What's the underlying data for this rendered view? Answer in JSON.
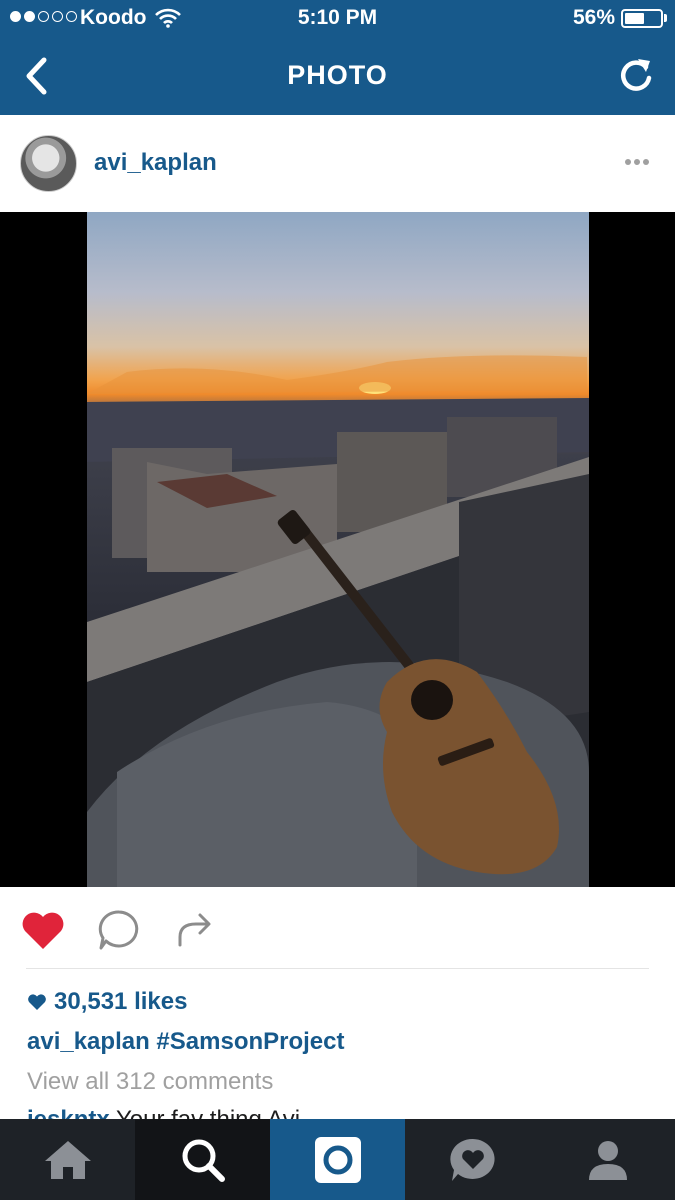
{
  "status_bar": {
    "carrier": "Koodo",
    "time": "5:10 PM",
    "battery": "56%",
    "battery_level": 0.56
  },
  "nav": {
    "title": "PHOTO",
    "back_icon": "chevron-left-icon",
    "refresh_icon": "refresh-icon"
  },
  "post": {
    "username": "avi_kaplan",
    "likes": "30,531 likes",
    "caption_user": "avi_kaplan",
    "caption_text": "#SamsonProject",
    "view_comments": "View all 312 comments",
    "comment_user": "jeskntx",
    "comment_text": "Your fav thing Avi..."
  },
  "tabbar": {
    "items": [
      "home-icon",
      "search-icon",
      "camera-icon",
      "activity-icon",
      "profile-icon"
    ],
    "active": "camera-icon"
  },
  "colors": {
    "brand": "#17598b",
    "like_red": "#e0243a",
    "tabbar": "#1e2227"
  }
}
